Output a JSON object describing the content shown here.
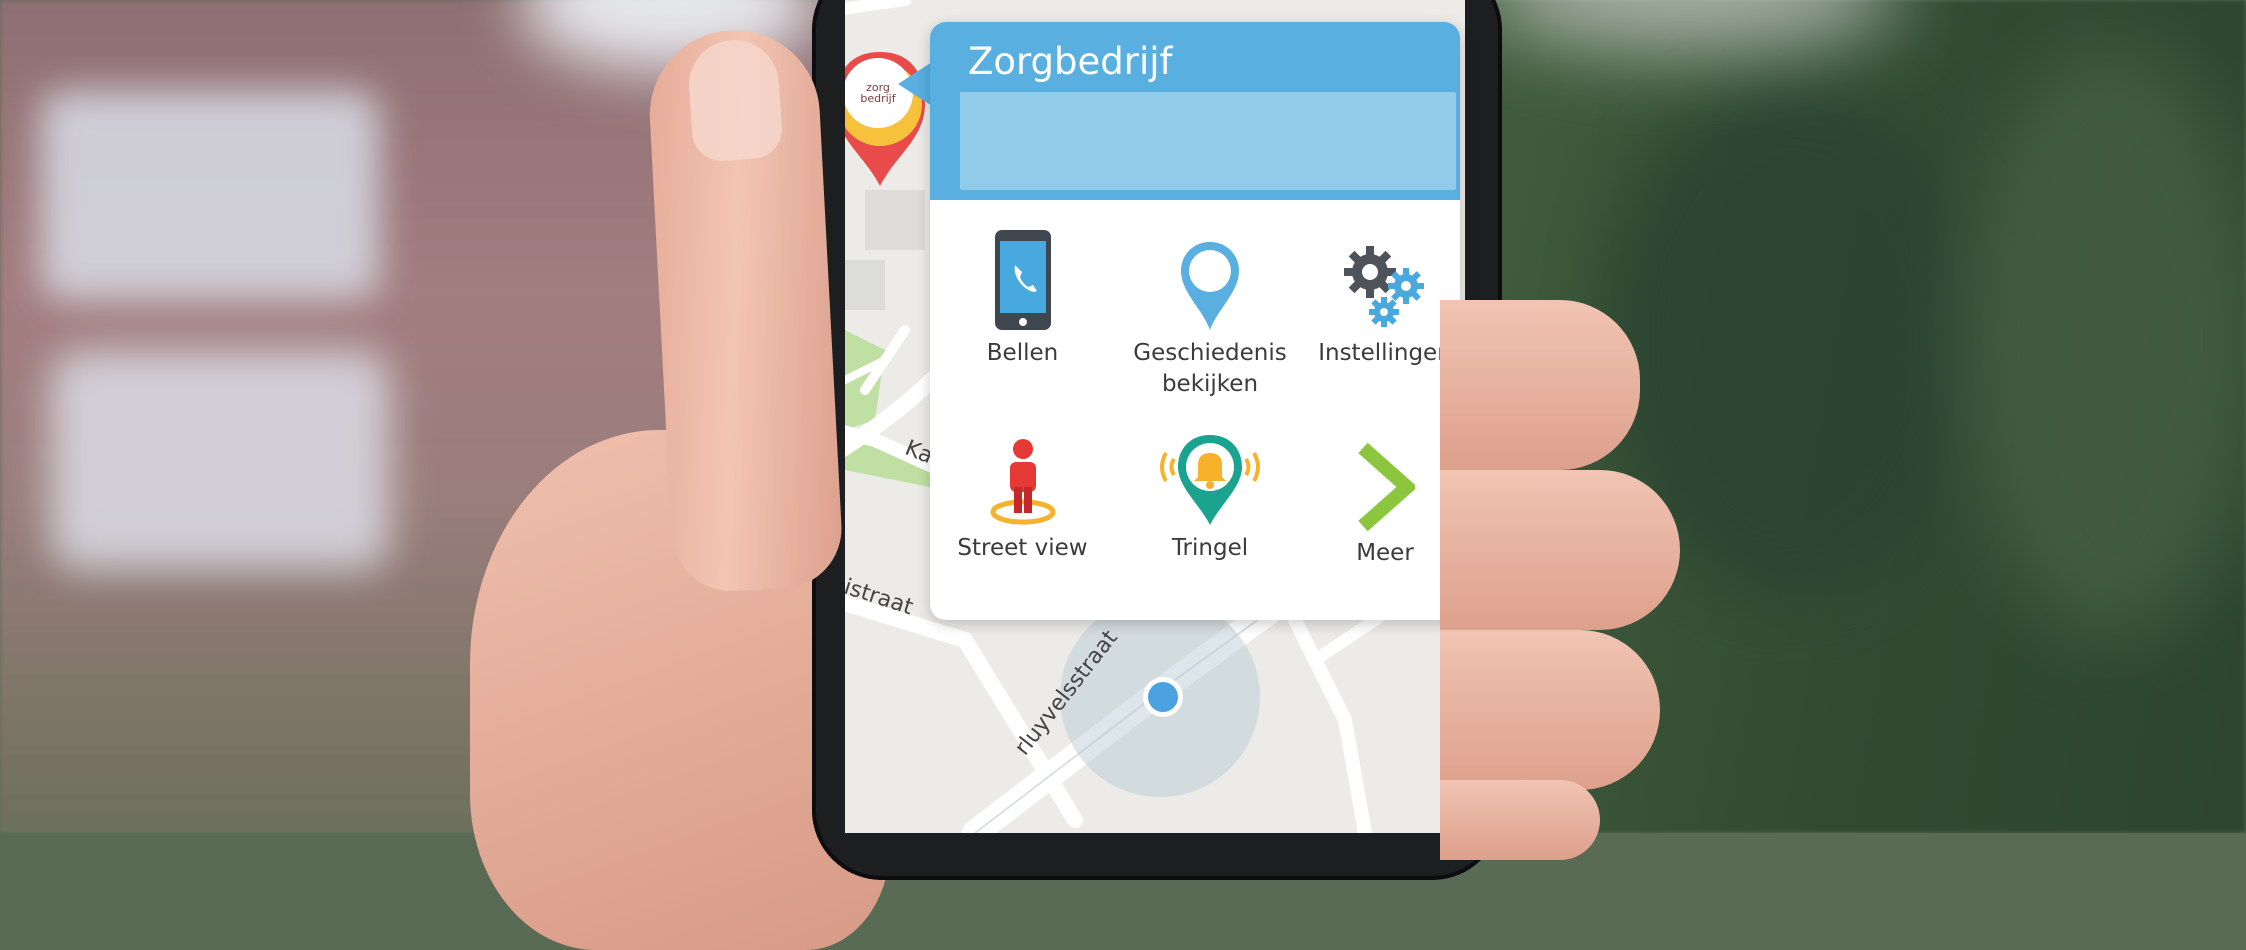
{
  "popup": {
    "title": "Zorgbedrijf",
    "input_value": "",
    "actions": [
      {
        "label": "Bellen",
        "icon": "phone-icon"
      },
      {
        "label": "Geschiedenis bekijken",
        "icon": "map-pin-icon"
      },
      {
        "label": "Instellingen",
        "icon": "gears-icon"
      },
      {
        "label": "Street view",
        "icon": "street-view-person-icon"
      },
      {
        "label": "Tringel",
        "icon": "bell-pin-icon"
      },
      {
        "label": "Meer",
        "icon": "chevron-right-icon"
      }
    ]
  },
  "map": {
    "roads": [
      {
        "label": "Ka"
      },
      {
        "label": "istraat"
      },
      {
        "label": "rluyvelsstraat"
      }
    ],
    "marker_logo": {
      "line1": "zorg",
      "line2": "bedrijf"
    }
  },
  "colors": {
    "header_blue": "#58afe0",
    "input_blue": "#91cbea",
    "location_dot": "#4ca2df",
    "marker_ring": "#e94b4b",
    "marker_inner": "#f6c23b",
    "chevron_green": "#8cc63f",
    "teal_pin": "#1aa48f",
    "bell_yellow": "#f5b22a"
  }
}
